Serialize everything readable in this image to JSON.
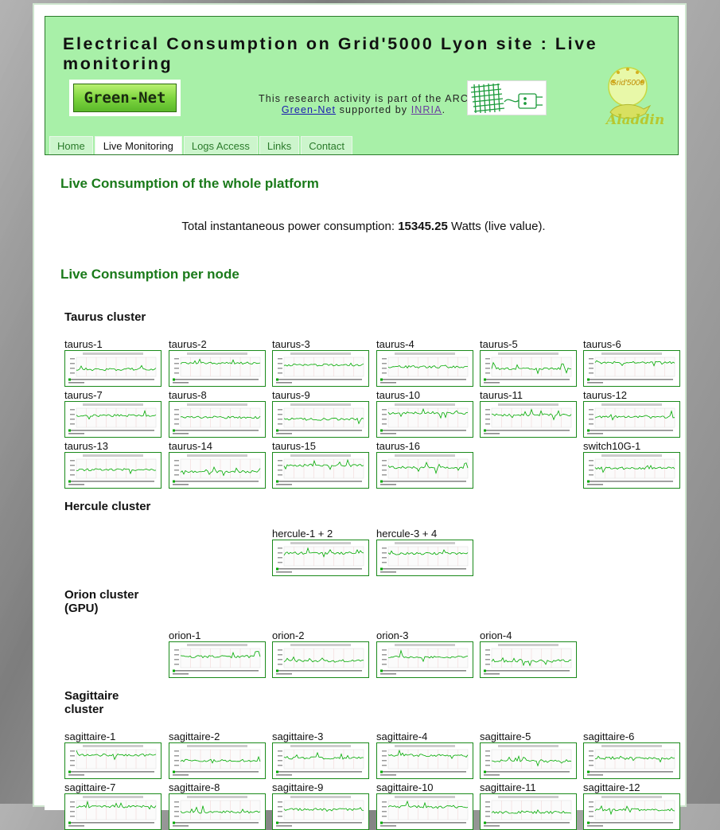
{
  "header": {
    "title": "Electrical Consumption on Grid'5000 Lyon site : Live monitoring",
    "greennet_logo_text": "Green-Net",
    "arc_line1": "This research activity is part of the ARC",
    "arc_link_greennet": "Green-Net",
    "arc_supported_by": " supported by ",
    "arc_link_inria": "INRIA",
    "arc_period": ".",
    "grid_logo_text": "Grid'5000",
    "aladdin_logo_text": "Aladdin"
  },
  "nav": {
    "tabs": [
      "Home",
      "Live Monitoring",
      "Logs Access",
      "Links",
      "Contact"
    ],
    "active": "Live Monitoring"
  },
  "whole_platform": {
    "heading": "Live Consumption of the whole platform",
    "total_prefix": "Total instantaneous power consumption: ",
    "total_value": "15345.25",
    "total_suffix": " Watts (live value)."
  },
  "per_node": {
    "heading": "Live Consumption per node"
  },
  "clusters": {
    "taurus": {
      "title": "Taurus cluster",
      "nodes": [
        "taurus-1",
        "taurus-2",
        "taurus-3",
        "taurus-4",
        "taurus-5",
        "taurus-6",
        "taurus-7",
        "taurus-8",
        "taurus-9",
        "taurus-10",
        "taurus-11",
        "taurus-12",
        "taurus-13",
        "taurus-14",
        "taurus-15",
        "taurus-16",
        "switch10G-1"
      ]
    },
    "hercule": {
      "title": "Hercule cluster",
      "nodes": [
        "hercule-1 + 2",
        "hercule-3 + 4"
      ]
    },
    "orion": {
      "title": "Orion cluster (GPU)",
      "nodes": [
        "orion-1",
        "orion-2",
        "orion-3",
        "orion-4"
      ]
    },
    "sagittaire": {
      "title": "Sagittaire cluster",
      "nodes": [
        "sagittaire-1",
        "sagittaire-2",
        "sagittaire-3",
        "sagittaire-4",
        "sagittaire-5",
        "sagittaire-6",
        "sagittaire-7",
        "sagittaire-8",
        "sagittaire-9",
        "sagittaire-10",
        "sagittaire-11",
        "sagittaire-12"
      ]
    }
  },
  "colors": {
    "header_bg": "#a8f0a8",
    "heading_green": "#1a7a1a",
    "graph_line": "#00aa00",
    "link_blue": "#1a1ab0"
  }
}
